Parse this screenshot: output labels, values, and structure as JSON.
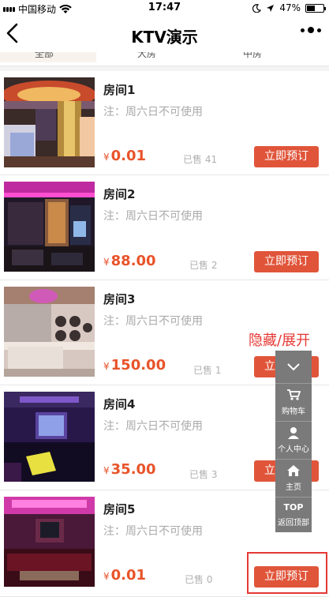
{
  "status_bar": {
    "carrier": "中国移动",
    "time": "17:47",
    "battery": "47%",
    "battery_level": 0.47
  },
  "nav": {
    "title": "KTV演示",
    "icons": {
      "back": "chevron-left-icon",
      "more": "more-dots-icon"
    }
  },
  "tabs": [
    "全部",
    "大房",
    "中房"
  ],
  "rooms": [
    {
      "name": "房间1",
      "note": "注：周六日不可使用",
      "currency": "¥",
      "price": "0.01",
      "sold": "已售 41",
      "button": "立即预订"
    },
    {
      "name": "房间2",
      "note": "注：周六日不可使用",
      "currency": "¥",
      "price": "88.00",
      "sold": "已售 2",
      "button": "立即预订"
    },
    {
      "name": "房间3",
      "note": "注：周六日不可使用",
      "currency": "¥",
      "price": "150.00",
      "sold": "已售 1",
      "button": "立即预订"
    },
    {
      "name": "房间4",
      "note": "注：周六日不可使用",
      "currency": "¥",
      "price": "35.00",
      "sold": "已售 3",
      "button": "立即预订"
    },
    {
      "name": "房间5",
      "note": "注：周六日不可使用",
      "currency": "¥",
      "price": "0.01",
      "sold": "已售 0",
      "button": "立即预订"
    }
  ],
  "float_panel": {
    "toggle_label": "隐藏/展开",
    "cart_label": "购物车",
    "user_label": "个人中心",
    "home_label": "主页",
    "top_text": "TOP",
    "top_label": "返回顶部"
  },
  "colors": {
    "accent": "#e0553a",
    "price": "#e8542a",
    "annotation": "#e53935",
    "panel": "#7a7a7a"
  }
}
